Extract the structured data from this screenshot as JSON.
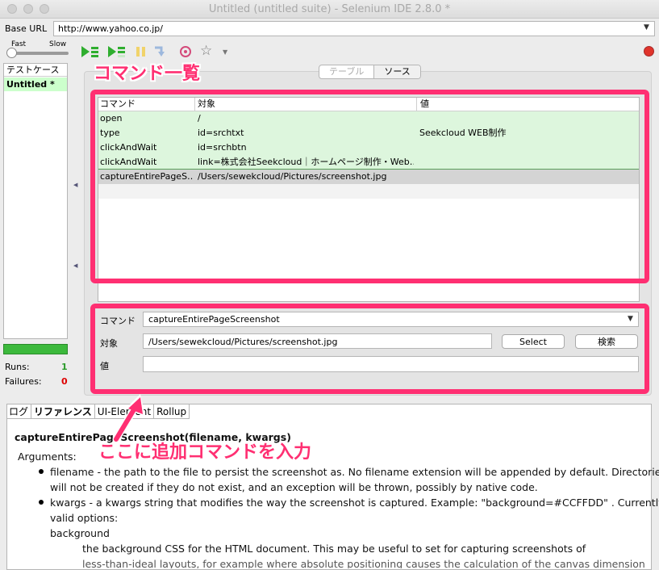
{
  "window": {
    "title": "Untitled (untitled suite) - Selenium IDE 2.8.0 *"
  },
  "base_url": {
    "label": "Base URL",
    "value": "http://www.yahoo.co.jp/"
  },
  "speed": {
    "fast": "Fast",
    "slow": "Slow"
  },
  "testcases": {
    "header": "テストケース",
    "items": [
      "Untitled *"
    ]
  },
  "stats": {
    "runs_label": "Runs:",
    "runs_value": "1",
    "failures_label": "Failures:",
    "failures_value": "0"
  },
  "view_tabs": [
    "テーブル",
    "ソース"
  ],
  "table": {
    "headers": [
      "コマンド",
      "対象",
      "値"
    ],
    "rows": [
      [
        "open",
        "/",
        ""
      ],
      [
        "type",
        "id=srchtxt",
        "Seekcloud WEB制作"
      ],
      [
        "clickAndWait",
        "id=srchbtn",
        ""
      ],
      [
        "clickAndWait",
        "link=株式会社Seekcloud｜ホームページ制作・Web…",
        ""
      ],
      [
        "captureEntirePageS…",
        "/Users/sewekcloud/Pictures/screenshot.jpg",
        ""
      ]
    ]
  },
  "editor": {
    "command_label": "コマンド",
    "command_value": "captureEntirePageScreenshot",
    "target_label": "対象",
    "target_value": "/Users/sewekcloud/Pictures/screenshot.jpg",
    "value_label": "値",
    "value_value": "",
    "select_button": "Select",
    "find_button": "検索"
  },
  "bottom_tabs": [
    "ログ",
    "リファレンス",
    "UI-Element",
    "Rollup"
  ],
  "reference": {
    "title": "captureEntirePageScreenshot(filename, kwargs)",
    "arguments_label": "Arguments:",
    "arg1_line1": "filename - the path to the file to persist the screenshot as. No filename extension will be appended by default. Directories",
    "arg1_line2": "will not be created if they do not exist, and an exception will be thrown, possibly by native code.",
    "arg2_line1": "kwargs - a kwargs string that modifies the way the screenshot is captured. Example: \"background=#CCFFDD\" . Currently",
    "arg2_line2": "valid options:",
    "option_name": "background",
    "option_desc": "the background CSS for the HTML document. This may be useful to set for capturing screenshots of",
    "option_desc2": "less-than-ideal layouts, for example where absolute positioning causes the calculation of the canvas dimension to"
  },
  "annotations": {
    "command_list": "コマンド一覧",
    "add_command_here": "ここに追加コマンドを入力",
    "color": "#ff2f72"
  },
  "icons": [
    "play-all-icon",
    "play-current-icon",
    "pause-icon",
    "step-icon",
    "rollup-icon",
    "bookmark-star-icon",
    "record-icon"
  ]
}
